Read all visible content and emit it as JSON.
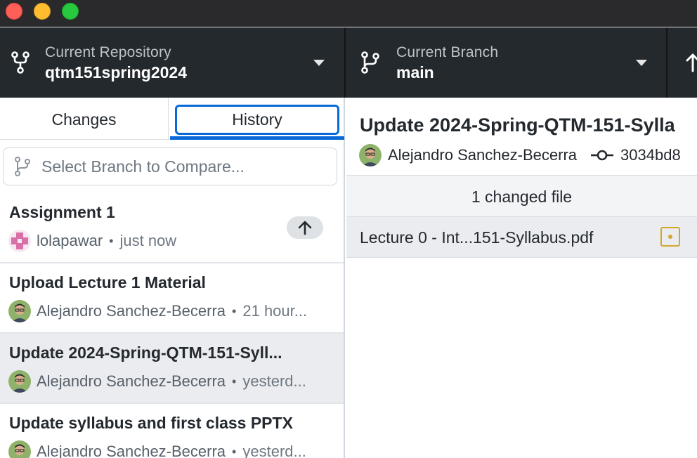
{
  "window": {
    "controls": [
      "close",
      "minimize",
      "maximize"
    ]
  },
  "toolbar": {
    "repository": {
      "label": "Current Repository",
      "value": "qtm151spring2024",
      "icon": "repo-fork-icon"
    },
    "branch": {
      "label": "Current Branch",
      "value": "main",
      "icon": "branch-icon"
    },
    "push": {
      "icon": "arrow-up-icon"
    }
  },
  "sidebar": {
    "tabs": [
      {
        "label": "Changes",
        "active": false
      },
      {
        "label": "History",
        "active": true
      }
    ],
    "compare": {
      "placeholder": "Select Branch to Compare..."
    },
    "commits": [
      {
        "title": "Assignment 1",
        "author": "lolapawar",
        "separator": "•",
        "time": "just now",
        "unpushed": true,
        "selected": false
      },
      {
        "title": "Upload Lecture 1 Material",
        "author": "Alejandro Sanchez-Becerra",
        "separator": "•",
        "time": "21 hour...",
        "unpushed": false,
        "selected": false
      },
      {
        "title": "Update 2024-Spring-QTM-151-Syll...",
        "author": "Alejandro Sanchez-Becerra",
        "separator": "•",
        "time": "yesterd...",
        "unpushed": false,
        "selected": true
      },
      {
        "title": "Update syllabus and first class PPTX",
        "author": "Alejandro Sanchez-Becerra",
        "separator": "•",
        "time": "yesterd...",
        "unpushed": false,
        "selected": false
      }
    ]
  },
  "main": {
    "title": "Update 2024-Spring-QTM-151-Sylla",
    "author": "Alejandro Sanchez-Becerra",
    "sha": "3034bd8",
    "changed_files_label": "1 changed file",
    "files": [
      {
        "name": "Lecture 0 - Int...151-Syllabus.pdf",
        "status": "modified"
      }
    ]
  },
  "colors": {
    "accent": "#0969da",
    "toolbar_bg": "#24292e",
    "modified": "#d4a72c",
    "selected_row": "#eaecef"
  }
}
